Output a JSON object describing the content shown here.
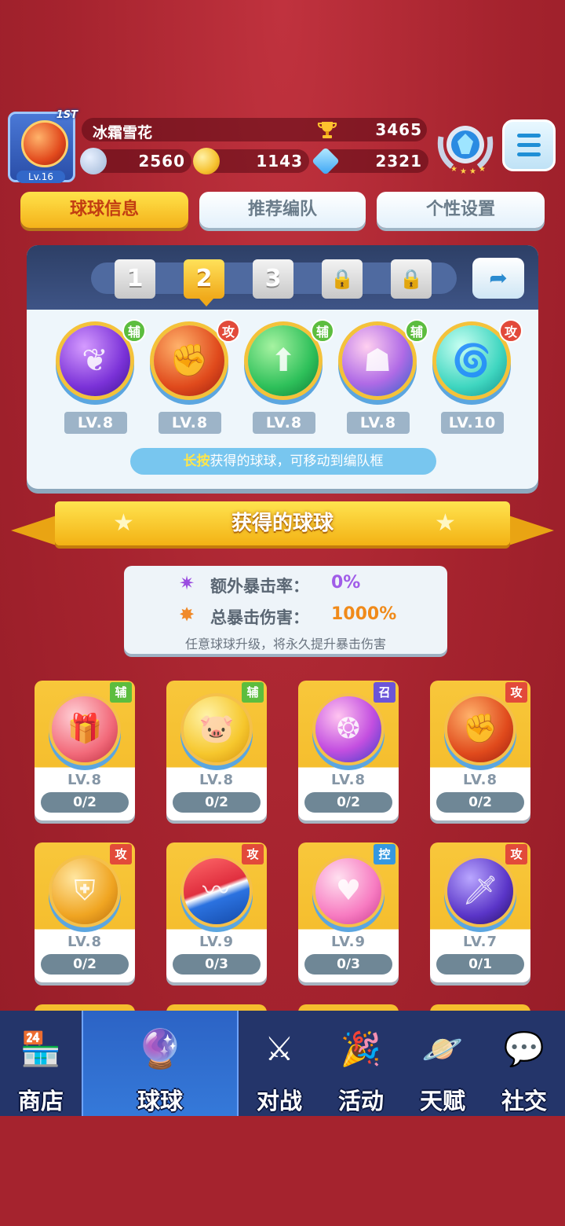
{
  "player": {
    "name": "冰霜雪花",
    "rank_tag": "1ST",
    "level": "Lv.16",
    "trophies": "3465"
  },
  "currencies": [
    {
      "name": "silver-coin",
      "value": "2560",
      "color": "#9fb7d6"
    },
    {
      "name": "gold-coin",
      "value": "1143",
      "color": "#f6c230"
    },
    {
      "name": "diamond",
      "value": "2321",
      "color": "#4fb7ff"
    }
  ],
  "tabs": [
    {
      "label": "球球信息",
      "active": true
    },
    {
      "label": "推荐编队",
      "active": false
    },
    {
      "label": "个性设置",
      "active": false
    }
  ],
  "lineup": {
    "slots": [
      {
        "label": "1"
      },
      {
        "label": "2",
        "active": true
      },
      {
        "label": "3"
      },
      {
        "label": "lock"
      },
      {
        "label": "lock"
      }
    ],
    "balls": [
      {
        "role": "辅",
        "level": "LV.8"
      },
      {
        "role": "攻",
        "level": "LV.8"
      },
      {
        "role": "辅",
        "level": "LV.8"
      },
      {
        "role": "辅",
        "level": "LV.8"
      },
      {
        "role": "攻",
        "level": "LV.10"
      }
    ],
    "hint_highlight": "长按",
    "hint_rest": "获得的球球，可移动到编队框"
  },
  "section_title": "获得的球球",
  "crit": {
    "extra_rate_label": "额外暴击率：",
    "extra_rate_value": "0%",
    "total_damage_label": "总暴击伤害：",
    "total_damage_value": "1000%",
    "note": "任意球球升级，将永久提升暴击伤害"
  },
  "cards": [
    {
      "role": "辅",
      "level": "LV.8",
      "count": "0/2"
    },
    {
      "role": "辅",
      "level": "LV.8",
      "count": "0/2"
    },
    {
      "role": "召",
      "level": "LV.8",
      "count": "0/2"
    },
    {
      "role": "攻",
      "level": "LV.8",
      "count": "0/2"
    },
    {
      "role": "攻",
      "level": "LV.8",
      "count": "0/2"
    },
    {
      "role": "攻",
      "level": "LV.9",
      "count": "0/3"
    },
    {
      "role": "控",
      "level": "LV.9",
      "count": "0/3"
    },
    {
      "role": "攻",
      "level": "LV.7",
      "count": "0/1"
    }
  ],
  "nav": [
    {
      "label": "商店",
      "icon": "shop-icon"
    },
    {
      "label": "球球",
      "icon": "balls-icon",
      "active": true
    },
    {
      "label": "对战",
      "icon": "battle-icon"
    },
    {
      "label": "活动",
      "icon": "event-icon"
    },
    {
      "label": "天赋",
      "icon": "talent-icon"
    },
    {
      "label": "社交",
      "icon": "social-icon"
    }
  ],
  "colors": {
    "accent_yellow": "#f4b21a",
    "role_support": "#5cbd3e",
    "role_attack": "#e24a3a",
    "role_summon": "#6b55d8",
    "role_control": "#3598e0"
  }
}
